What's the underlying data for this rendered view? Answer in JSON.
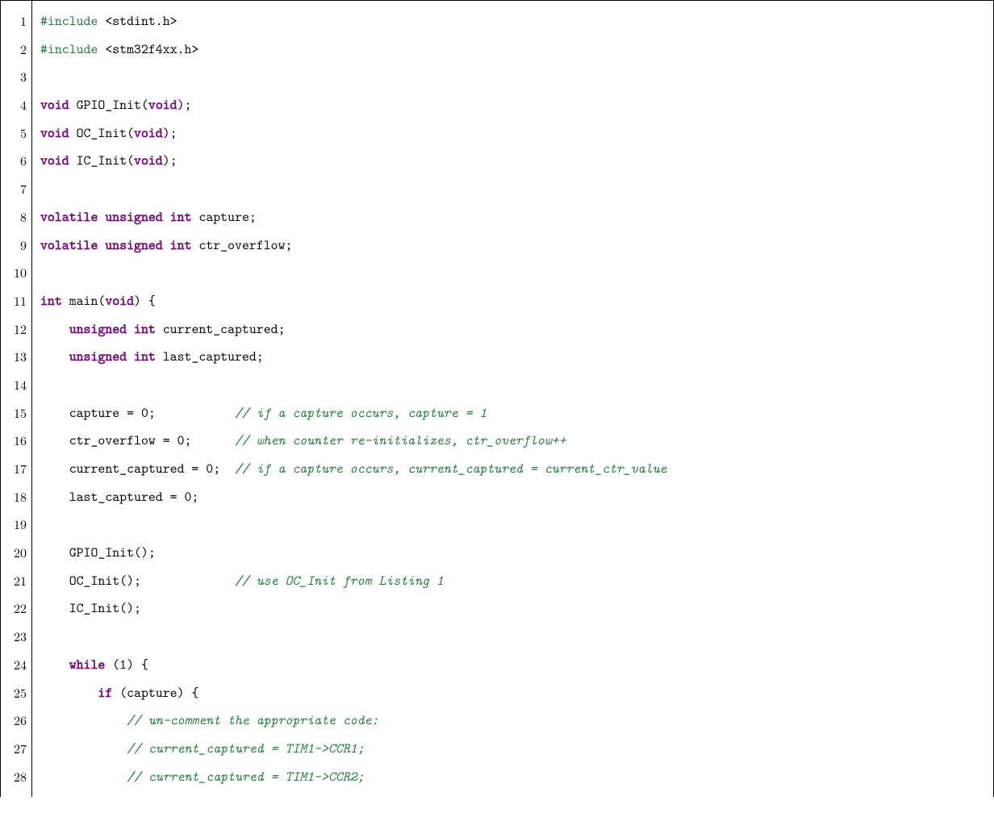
{
  "lines": [
    {
      "num": "1",
      "tokens": [
        {
          "cls": "pp",
          "t": "#include"
        },
        {
          "cls": "plain",
          "t": " <stdint.h>"
        }
      ]
    },
    {
      "num": "2",
      "tokens": [
        {
          "cls": "pp",
          "t": "#include"
        },
        {
          "cls": "plain",
          "t": " <stm32f4xx.h>"
        }
      ]
    },
    {
      "num": "3",
      "tokens": [
        {
          "cls": "plain",
          "t": ""
        }
      ]
    },
    {
      "num": "4",
      "tokens": [
        {
          "cls": "kw",
          "t": "void"
        },
        {
          "cls": "plain",
          "t": " GPIO_Init("
        },
        {
          "cls": "kw",
          "t": "void"
        },
        {
          "cls": "plain",
          "t": ");"
        }
      ]
    },
    {
      "num": "5",
      "tokens": [
        {
          "cls": "kw",
          "t": "void"
        },
        {
          "cls": "plain",
          "t": " OC_Init("
        },
        {
          "cls": "kw",
          "t": "void"
        },
        {
          "cls": "plain",
          "t": ");"
        }
      ]
    },
    {
      "num": "6",
      "tokens": [
        {
          "cls": "kw",
          "t": "void"
        },
        {
          "cls": "plain",
          "t": " IC_Init("
        },
        {
          "cls": "kw",
          "t": "void"
        },
        {
          "cls": "plain",
          "t": ");"
        }
      ]
    },
    {
      "num": "7",
      "tokens": [
        {
          "cls": "plain",
          "t": ""
        }
      ]
    },
    {
      "num": "8",
      "tokens": [
        {
          "cls": "kw",
          "t": "volatile"
        },
        {
          "cls": "plain",
          "t": " "
        },
        {
          "cls": "kw",
          "t": "unsigned"
        },
        {
          "cls": "plain",
          "t": " "
        },
        {
          "cls": "kw",
          "t": "int"
        },
        {
          "cls": "plain",
          "t": " capture;"
        }
      ]
    },
    {
      "num": "9",
      "tokens": [
        {
          "cls": "kw",
          "t": "volatile"
        },
        {
          "cls": "plain",
          "t": " "
        },
        {
          "cls": "kw",
          "t": "unsigned"
        },
        {
          "cls": "plain",
          "t": " "
        },
        {
          "cls": "kw",
          "t": "int"
        },
        {
          "cls": "plain",
          "t": " ctr_overflow;"
        }
      ]
    },
    {
      "num": "10",
      "tokens": [
        {
          "cls": "plain",
          "t": ""
        }
      ]
    },
    {
      "num": "11",
      "tokens": [
        {
          "cls": "kw",
          "t": "int"
        },
        {
          "cls": "plain",
          "t": " main("
        },
        {
          "cls": "kw",
          "t": "void"
        },
        {
          "cls": "plain",
          "t": ") {"
        }
      ]
    },
    {
      "num": "12",
      "tokens": [
        {
          "cls": "plain",
          "t": "    "
        },
        {
          "cls": "kw",
          "t": "unsigned"
        },
        {
          "cls": "plain",
          "t": " "
        },
        {
          "cls": "kw",
          "t": "int"
        },
        {
          "cls": "plain",
          "t": " current_captured;"
        }
      ]
    },
    {
      "num": "13",
      "tokens": [
        {
          "cls": "plain",
          "t": "    "
        },
        {
          "cls": "kw",
          "t": "unsigned"
        },
        {
          "cls": "plain",
          "t": " "
        },
        {
          "cls": "kw",
          "t": "int"
        },
        {
          "cls": "plain",
          "t": " last_captured;"
        }
      ]
    },
    {
      "num": "14",
      "tokens": [
        {
          "cls": "plain",
          "t": ""
        }
      ]
    },
    {
      "num": "15",
      "tokens": [
        {
          "cls": "plain",
          "t": "    capture = 0;           "
        },
        {
          "cls": "cm",
          "t": "// if a capture occurs, capture = 1"
        }
      ]
    },
    {
      "num": "16",
      "tokens": [
        {
          "cls": "plain",
          "t": "    ctr_overflow = 0;      "
        },
        {
          "cls": "cm",
          "t": "// when counter re-initializes, ctr_overflow++"
        }
      ]
    },
    {
      "num": "17",
      "tokens": [
        {
          "cls": "plain",
          "t": "    current_captured = 0;  "
        },
        {
          "cls": "cm",
          "t": "// if a capture occurs, current_captured = current_ctr_value"
        }
      ]
    },
    {
      "num": "18",
      "tokens": [
        {
          "cls": "plain",
          "t": "    last_captured = 0;"
        }
      ]
    },
    {
      "num": "19",
      "tokens": [
        {
          "cls": "plain",
          "t": ""
        }
      ]
    },
    {
      "num": "20",
      "tokens": [
        {
          "cls": "plain",
          "t": "    GPIO_Init();"
        }
      ]
    },
    {
      "num": "21",
      "tokens": [
        {
          "cls": "plain",
          "t": "    OC_Init();             "
        },
        {
          "cls": "cm",
          "t": "// use OC_Init from Listing 1"
        }
      ]
    },
    {
      "num": "22",
      "tokens": [
        {
          "cls": "plain",
          "t": "    IC_Init();"
        }
      ]
    },
    {
      "num": "23",
      "tokens": [
        {
          "cls": "plain",
          "t": ""
        }
      ]
    },
    {
      "num": "24",
      "tokens": [
        {
          "cls": "plain",
          "t": "    "
        },
        {
          "cls": "kw",
          "t": "while"
        },
        {
          "cls": "plain",
          "t": " (1) {"
        }
      ]
    },
    {
      "num": "25",
      "tokens": [
        {
          "cls": "plain",
          "t": "        "
        },
        {
          "cls": "kw",
          "t": "if"
        },
        {
          "cls": "plain",
          "t": " (capture) {"
        }
      ]
    },
    {
      "num": "26",
      "tokens": [
        {
          "cls": "plain",
          "t": "            "
        },
        {
          "cls": "cm",
          "t": "// un-comment the appropriate code:"
        }
      ]
    },
    {
      "num": "27",
      "tokens": [
        {
          "cls": "plain",
          "t": "            "
        },
        {
          "cls": "cm",
          "t": "// current_captured = TIM1->CCR1;"
        }
      ]
    },
    {
      "num": "28",
      "tokens": [
        {
          "cls": "plain",
          "t": "            "
        },
        {
          "cls": "cm",
          "t": "// current_captured = TIM1->CCR2;"
        }
      ]
    }
  ]
}
